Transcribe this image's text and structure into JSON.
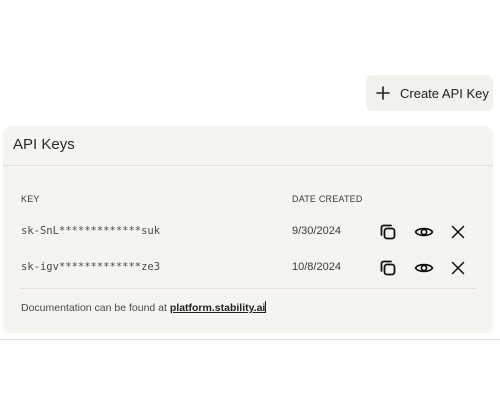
{
  "header": {
    "create_button_label": "Create API Key"
  },
  "card": {
    "title": "API Keys",
    "columns": {
      "key": "KEY",
      "date_created": "DATE CREATED"
    },
    "rows": [
      {
        "key": "sk-SnL*************suk",
        "date": "9/30/2024"
      },
      {
        "key": "sk-igv*************ze3",
        "date": "10/8/2024"
      }
    ],
    "footer": {
      "text": "Documentation can be found at ",
      "link_text": "platform.stability.ai"
    }
  },
  "icons": {
    "create": "plus-icon",
    "copy": "copy-icon",
    "reveal": "eye-icon",
    "delete": "close-icon"
  }
}
